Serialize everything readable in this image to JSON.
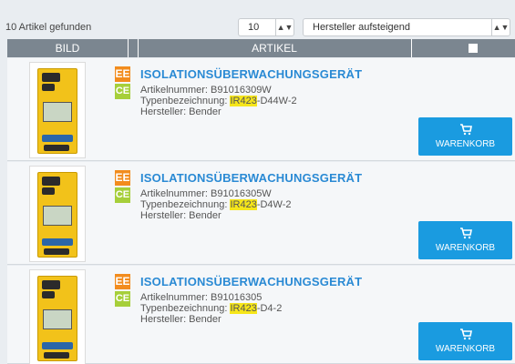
{
  "toolbar": {
    "count_text": "10 Artikel gefunden",
    "per_page": "10",
    "sort": "Hersteller aufsteigend"
  },
  "table_header": {
    "col_image": "BILD",
    "col_article": "ARTIKEL"
  },
  "products": [
    {
      "badge_ee": "EE",
      "badge_ce": "CE",
      "title": "ISOLATIONSÜBERWACHUNGSGERÄT",
      "article_label": "Artikelnummer: ",
      "article_no": "B91016309W",
      "type_label": "Typenbezeichnung: ",
      "type_hl": "IR423",
      "type_rest": "-D44W-2",
      "manufacturer": "Hersteller: Bender",
      "cart_label": "WARENKORB"
    },
    {
      "badge_ee": "EE",
      "badge_ce": "CE",
      "title": "ISOLATIONSÜBERWACHUNGSGERÄT",
      "article_label": "Artikelnummer: ",
      "article_no": "B91016305W",
      "type_label": "Typenbezeichnung: ",
      "type_hl": "IR423",
      "type_rest": "-D4W-2",
      "manufacturer": "Hersteller: Bender",
      "cart_label": "WARENKORB"
    },
    {
      "badge_ee": "EE",
      "badge_ce": "CE",
      "title": "ISOLATIONSÜBERWACHUNGSGERÄT",
      "article_label": "Artikelnummer: ",
      "article_no": "B91016305",
      "type_label": "Typenbezeichnung: ",
      "type_hl": "IR423",
      "type_rest": "-D4-2",
      "manufacturer": "Hersteller: Bender",
      "cart_label": "WARENKORB"
    }
  ],
  "icons": {
    "select_arrows": "updown-arrows-icon",
    "cart": "shopping-cart-icon",
    "select_all": "checkbox-icon"
  },
  "colors": {
    "header_bg": "#7b8690",
    "title": "#2a8ad4",
    "cart_button": "#1a9be0",
    "ee_badge": "#f28c1e",
    "ce_badge": "#a6cf3a",
    "highlight": "#f6e61a"
  }
}
